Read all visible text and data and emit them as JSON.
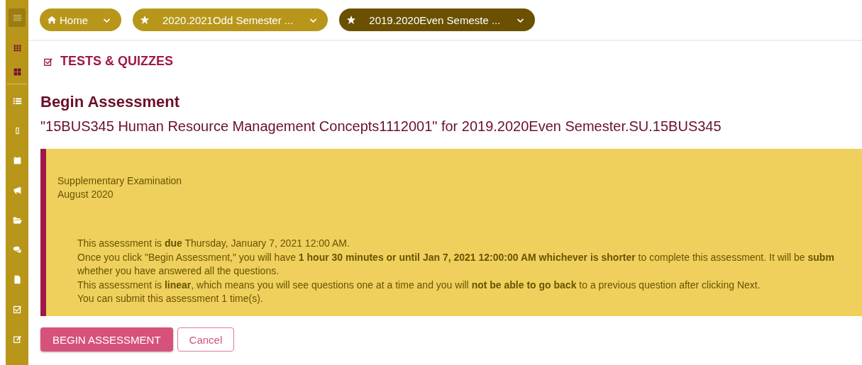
{
  "sidebar": {
    "items": [
      {
        "kind": "menu",
        "selected": true
      },
      {
        "kind": "apps",
        "selected": false
      },
      {
        "kind": "dashboard",
        "selected": false
      },
      {
        "kind": "list",
        "selected": false
      },
      {
        "kind": "rect",
        "selected": false
      },
      {
        "kind": "calendar",
        "selected": false
      },
      {
        "kind": "megaphone",
        "selected": false
      },
      {
        "kind": "folder",
        "selected": false
      },
      {
        "kind": "chat",
        "selected": false
      },
      {
        "kind": "document",
        "selected": false
      },
      {
        "kind": "check",
        "selected": false
      },
      {
        "kind": "edit",
        "selected": false
      }
    ]
  },
  "breadcrumbs": [
    {
      "label": "Home",
      "kind": "home",
      "selected": false
    },
    {
      "label": "2020.2021Odd Semester ...",
      "kind": "star",
      "selected": false
    },
    {
      "label": "2019.2020Even Semeste ...",
      "kind": "star",
      "selected": true
    }
  ],
  "tool_title": "TESTS & QUIZZES",
  "heading": "Begin Assessment",
  "subheading": "\"15BUS345 Human Resource Management Concepts1112001\" for 2019.2020Even Semester.SU.15BUS345",
  "notice": {
    "intro": [
      "Supplementary Examination",
      "August 2020"
    ],
    "lines": [
      "This assessment is **due** Thursday, January 7, 2021 12:00 AM.",
      "Once you click \"Begin Assessment,\" you will have **1 hour 30 minutes or until Jan 7, 2021 12:00:00 AM whichever is shorter** to complete this assessment. It will be **subm**",
      "whether you have answered all the questions.",
      "This assessment is **linear**, which means you will see questions one at a time and you will **not be able to go back** to a previous question after clicking Next.",
      "You can submit this assessment 1 time(s)."
    ]
  },
  "buttons": [
    {
      "label": "BEGIN ASSESSMENT",
      "kind": "primary"
    },
    {
      "label": "Cancel",
      "kind": "secondary"
    }
  ]
}
